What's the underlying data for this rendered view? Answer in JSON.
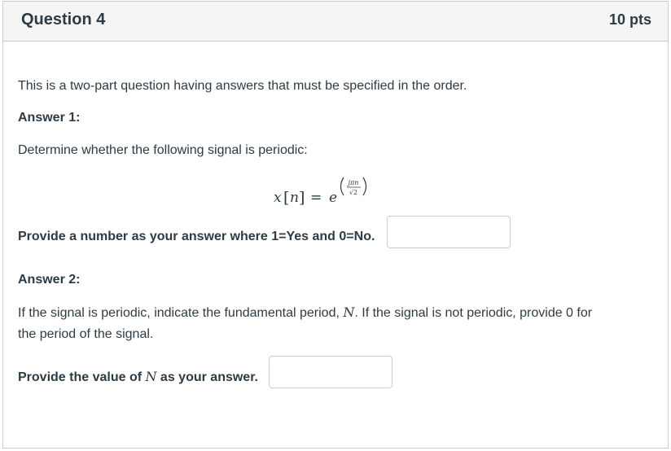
{
  "question": {
    "title": "Question 4",
    "points": "10 pts"
  },
  "intro": "This is a two-part question having answers that must be specified in the order.",
  "part1": {
    "heading": "Answer 1:",
    "prompt": "Determine whether the following signal is periodic:",
    "equation": {
      "lhs_var": "x",
      "lhs_index": "n",
      "equals": "=",
      "base": "e",
      "exp_numerator": "jπn",
      "exp_denominator": "√2"
    },
    "answer_label": "Provide a number as your answer where 1=Yes and 0=No.",
    "answer_value": ""
  },
  "part2": {
    "heading": "Answer 2:",
    "prompt_line1_before": "If the signal is periodic, indicate the fundamental period, ",
    "prompt_var": "N",
    "prompt_line1_after": ". If the signal is not periodic, provide 0 for",
    "prompt_line2": "the period of the signal.",
    "answer_label_before": "Provide the value of ",
    "answer_label_var": "N",
    "answer_label_after": " as your answer.",
    "answer_value": ""
  }
}
